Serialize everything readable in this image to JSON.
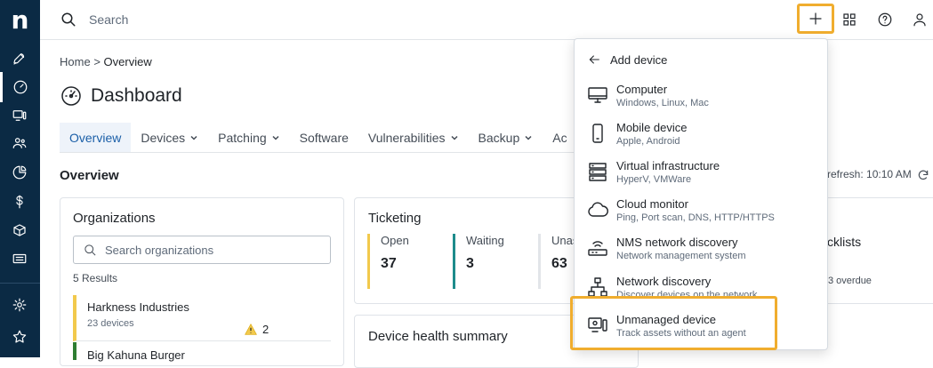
{
  "sidebar": {
    "logo": "n",
    "items": [
      {
        "icon": "rocket-icon"
      },
      {
        "icon": "dashboard-icon"
      },
      {
        "icon": "devices-icon"
      },
      {
        "icon": "users-icon"
      },
      {
        "icon": "pie-chart-icon"
      },
      {
        "icon": "dollar-icon"
      },
      {
        "icon": "box-icon"
      },
      {
        "icon": "ticket-icon"
      },
      {
        "icon": "gear-icon"
      },
      {
        "icon": "star-icon"
      }
    ]
  },
  "topbar": {
    "search_placeholder": "Search"
  },
  "breadcrumb": {
    "home": "Home",
    "separator": ">",
    "current": "Overview"
  },
  "page": {
    "title": "Dashboard"
  },
  "tabs": [
    {
      "label": "Overview",
      "active": true
    },
    {
      "label": "Devices"
    },
    {
      "label": "Patching"
    },
    {
      "label": "Software"
    },
    {
      "label": "Vulnerabilities"
    },
    {
      "label": "Backup"
    },
    {
      "label": "Ac"
    }
  ],
  "overview": {
    "title": "Overview",
    "refresh_text": "refresh: 10:10 AM"
  },
  "organizations": {
    "title": "Organizations",
    "search_placeholder": "Search organizations",
    "results": "5 Results",
    "items": [
      {
        "name": "Harkness Industries",
        "devices": "23 devices",
        "warnings": "2",
        "color": "#f2c94c"
      },
      {
        "name": "Big Kahuna Burger",
        "color": "#2e7d32"
      }
    ]
  },
  "ticketing": {
    "title": "Ticketing",
    "columns": [
      {
        "label": "Open",
        "value": "37",
        "color": "#f2c94c"
      },
      {
        "label": "Waiting",
        "value": "3",
        "color": "#1e8c8c"
      },
      {
        "label": "Unas",
        "value": "63",
        "color": "#e2e5e9"
      }
    ]
  },
  "device_health": {
    "title": "Device health summary"
  },
  "right_partial": {
    "checklists": "cklists",
    "overdue": "3 overdue"
  },
  "add_device": {
    "header": "Add device",
    "items": [
      {
        "icon": "computer-icon",
        "title": "Computer",
        "subtitle": "Windows, Linux, Mac"
      },
      {
        "icon": "mobile-device-icon",
        "title": "Mobile device",
        "subtitle": "Apple, Android"
      },
      {
        "icon": "server-icon",
        "title": "Virtual infrastructure",
        "subtitle": "HyperV, VMWare"
      },
      {
        "icon": "cloud-icon",
        "title": "Cloud monitor",
        "subtitle": "Ping, Port scan, DNS, HTTP/HTTPS"
      },
      {
        "icon": "router-icon",
        "title": "NMS network discovery",
        "subtitle": "Network management system"
      },
      {
        "icon": "network-icon",
        "title": "Network discovery",
        "subtitle": "Discover devices on the network"
      },
      {
        "icon": "unmanaged-device-icon",
        "title": "Unmanaged device",
        "subtitle": "Track assets without an agent"
      }
    ]
  },
  "colors": {
    "sidebar_bg": "#0b2a44",
    "accent": "#1b5fa8",
    "highlight": "#f0ad2e"
  }
}
